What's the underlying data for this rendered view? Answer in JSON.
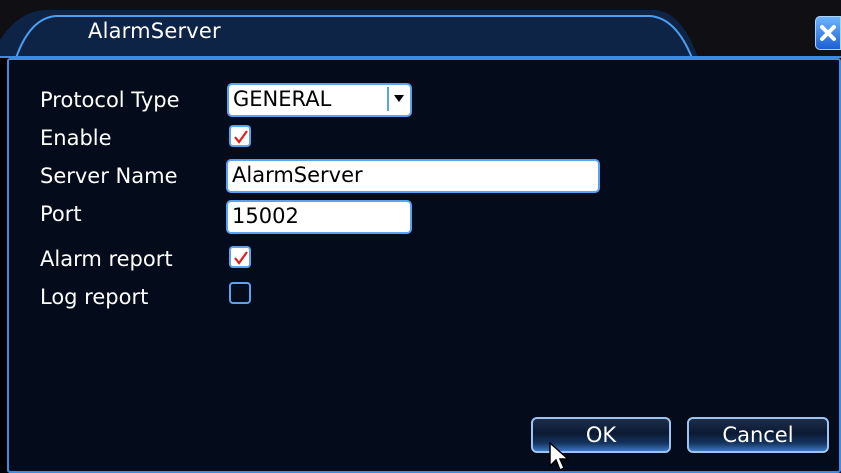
{
  "window": {
    "title": "AlarmServer",
    "close_icon": "close-icon"
  },
  "form": {
    "protocol_type": {
      "label": "Protocol Type",
      "value": "GENERAL"
    },
    "enable": {
      "label": "Enable",
      "checked": true
    },
    "server_name": {
      "label": "Server Name",
      "value": "AlarmServer"
    },
    "port": {
      "label": "Port",
      "value": "15002"
    },
    "alarm_report": {
      "label": "Alarm report",
      "checked": true
    },
    "log_report": {
      "label": "Log report",
      "checked": false
    }
  },
  "buttons": {
    "ok_label": "OK",
    "cancel_label": "Cancel"
  },
  "colors": {
    "dialog_background": "#040c1c",
    "border_accent": "#3a8de6",
    "check_mark": "#e02020"
  }
}
